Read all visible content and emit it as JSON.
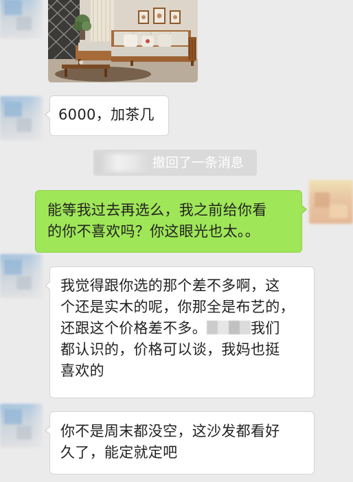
{
  "chat": {
    "recall_notice": "撤回了一条消息",
    "messages": [
      {
        "id": "m1",
        "sender": "contact",
        "lines": [
          "6000，加茶几"
        ]
      },
      {
        "id": "m2",
        "sender": "me",
        "lines": [
          "能等我过去再选么，我之前给你看",
          "的你不喜欢吗？你这眼光也太。。"
        ]
      },
      {
        "id": "m3",
        "sender": "contact",
        "lines": [
          "我觉得跟你选的那个差不多啊，这",
          "个还是实木的呢，你那全是布艺的，",
          "还跟这个价格差不多。",
          "我们",
          "都认识的，价格可以谈，我妈也挺",
          "喜欢的"
        ]
      },
      {
        "id": "m4",
        "sender": "contact",
        "lines": [
          "你不是周末都没空，这沙发都看好",
          "久了，能定就定吧"
        ]
      }
    ],
    "image_message": {
      "subject": "sofa-photo"
    }
  },
  "colors": {
    "background": "#ebebeb",
    "incoming_bubble": "#ffffff",
    "outgoing_bubble": "#9fe658",
    "recall_bg": "#dadada"
  }
}
